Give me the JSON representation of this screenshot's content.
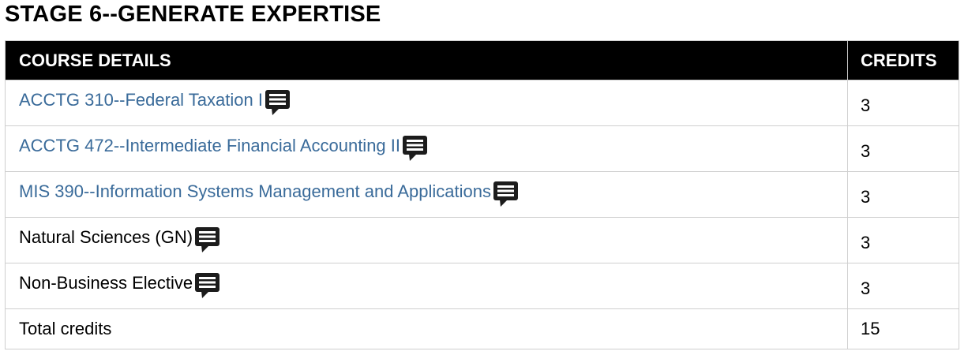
{
  "stage_title": "STAGE 6--GENERATE EXPERTISE",
  "table": {
    "headers": {
      "details": "COURSE DETAILS",
      "credits": "CREDITS"
    },
    "rows": [
      {
        "course": "ACCTG 310--Federal Taxation I",
        "credits": "3",
        "is_link": true,
        "icon": "comment-icon"
      },
      {
        "course": "ACCTG 472--Intermediate Financial Accounting II",
        "credits": "3",
        "is_link": true,
        "icon": "comment-icon"
      },
      {
        "course": "MIS 390--Information Systems Management and Applications",
        "credits": "3",
        "is_link": true,
        "icon": "comment-icon"
      },
      {
        "course": "Natural Sciences (GN)",
        "credits": "3",
        "is_link": false,
        "icon": "comment-icon"
      },
      {
        "course": "Non-Business Elective",
        "credits": "3",
        "is_link": false,
        "icon": "comment-icon"
      }
    ],
    "total": {
      "label": "Total credits",
      "credits": "15"
    }
  },
  "colors": {
    "link": "#3a6b9a",
    "header_bg": "#000000",
    "border": "#cfcfcf"
  }
}
